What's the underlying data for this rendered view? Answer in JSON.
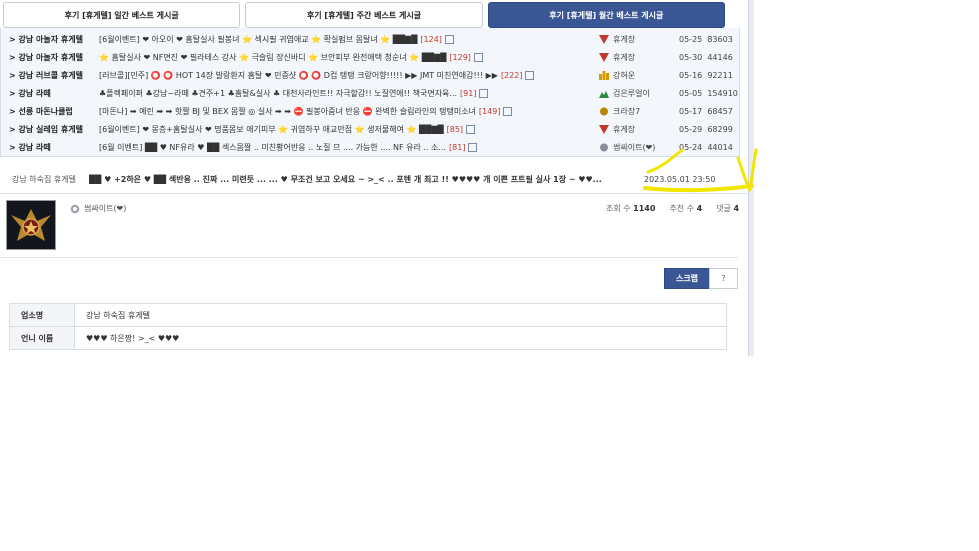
{
  "tabs": [
    {
      "label": "후기 [휴게텔] 일간 베스트 게시글",
      "active": false
    },
    {
      "label": "후기 [휴게텔] 주간 베스트 게시글",
      "active": false
    },
    {
      "label": "후기 [휴게텔] 월간 베스트 게시글",
      "active": true
    }
  ],
  "best_list": [
    {
      "category": "> 강남 아놀자 휴게텔",
      "title": "[6월이벤트] ❤ 아오이 ❤ 홈탈실사 필봉녀 ⭐ 섹시필 귀염애교 ⭐ 확실펌브 몸탈녀 ⭐ ██▇█",
      "count": "[124]",
      "author": "휴게장",
      "badge": "#c0392b",
      "date": "05-25",
      "views": "83603"
    },
    {
      "category": "> 강남 아놀자 휴게텔",
      "title": "⭐ 홈탈실사 ❤ NF면진 ❤ 필라테스 강사 ⭐ 극슬림 장신바디 ⭐ 브안피부 완전애택 청순녀 ⭐ ██▇█",
      "count": "[129]",
      "author": "휴게장",
      "badge": "#c0392b",
      "date": "05-30",
      "views": "44146"
    },
    {
      "category": "> 강남 러브콜 휴게텔",
      "title": "[러브콜][민주] ⭕ ⭕ HOT 14장 발랑환지 홈탈 ❤ 민증샷 ⭕ ⭕ D컵 탱탱 크랑어향!!!!! ▶▶ JMT 미친연애감!!! ▶▶",
      "count": "[222]",
      "author": "강혀운",
      "badge": "#d49b00",
      "date": "05-16",
      "views": "92211"
    },
    {
      "category": "> 강남 라떼",
      "title": "♣플렉페이퍼 ♣강남~라떼 ♣견주+1 ♣홈탈&실사 ♣ 대천사라인트!! 자극할감!! 노질연애!! 책국면자육...",
      "count": "[91]",
      "author": "검은루얼이",
      "badge": "#2b8a3e",
      "date": "05-05",
      "views": "154910"
    },
    {
      "category": "> 선릉 마돈나클럽",
      "title": "[마돈나] ➡ 예린 ➡ ➡ 핫짤 BJ 및 BEX 몸짤 ◎ 실사 ➡ ➡ ⛔ 필봉아줌녀 반응 ⛔ 완벽한 슬림라인의 탱탱미소녀",
      "count": "[149]",
      "author": "크라장7",
      "badge": "#b8860b",
      "date": "05-17",
      "views": "68457"
    },
    {
      "category": "> 강남 실레임 휴게텔",
      "title": "[6월이벤트] ❤ 몽층+홈탈실사 ❤ 명품몸보 애기피부 ⭐ 귀염하꾸 애교만점 ⭐ 생저물해여 ⭐ ██▇█",
      "count": "[85]",
      "author": "휴게장",
      "badge": "#c0392b",
      "date": "05-29",
      "views": "68299"
    },
    {
      "category": "> 강남 라떼",
      "title": "[6월 이벤트] ██ ♥ NF유라 ♥ ██ 섹스몸짤 .. 미친황어반응 .. 노질 므 .... 가능한 .... NF 유라 .. 소...",
      "count": "[81]",
      "author": "썸싸이트(❤)",
      "badge": "#8a8f99",
      "date": "05-24",
      "views": "44014"
    }
  ],
  "post": {
    "category": "강남 하숙집 휴게텔",
    "title": "██ ♥ +2하은 ♥ ██ 섹반응 .. 진짜 ... 미련듯 ... ... ♥ 무조건 보고 오세요 ~ >_< .. 포텐 개 최고 !! ♥♥♥♥ 개 이쁜 프트필 실사 1장 ~ ♥♥...",
    "datetime": "2023.05.01 23:50",
    "author_nick": "썸싸이트(❤)",
    "views_label": "조회 수",
    "views": "1140",
    "likes_label": "추천 수",
    "likes": "4",
    "comments_label": "댓글",
    "comments": "4",
    "scrap_label": "스크랩",
    "help_label": "?"
  },
  "info_table": [
    {
      "key": "업소명",
      "value": "강남 하숙집 휴게텔"
    },
    {
      "key": "언니 이름",
      "value": "♥♥♥ 하은짱! >_< ♥♥♥"
    }
  ],
  "colors": {
    "accent": "#3b5694",
    "annotation": "#f2e600",
    "count_red": "#c0392b"
  },
  "icons": {
    "file": "file-icon",
    "user_badge": "user-badge-icon",
    "avatar": "avatar-emblem"
  }
}
